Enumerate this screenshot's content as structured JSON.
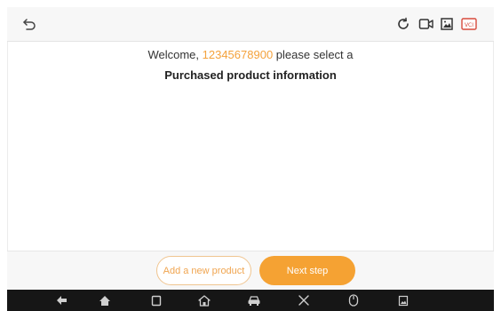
{
  "toolbar": {
    "back_icon": "back-arrow-icon",
    "right_icons": [
      "refresh-icon",
      "video-record-icon",
      "image-icon",
      "vci-icon"
    ],
    "vci_label": "VCI"
  },
  "welcome": {
    "prefix": "Welcome, ",
    "phone": "12345678900",
    "suffix": " please select a",
    "subtitle": "Purchased product information"
  },
  "actions": {
    "add_label": "Add a new product",
    "next_label": "Next step"
  },
  "navbar": {
    "icons": [
      "back-icon",
      "home-icon",
      "recent-apps-icon",
      "house-icon",
      "car-icon",
      "tools-icon",
      "mouse-icon",
      "screenshot-icon"
    ]
  },
  "colors": {
    "accent": "#f5a233",
    "accent_text": "#f4a23c",
    "navbar": "#161616"
  }
}
